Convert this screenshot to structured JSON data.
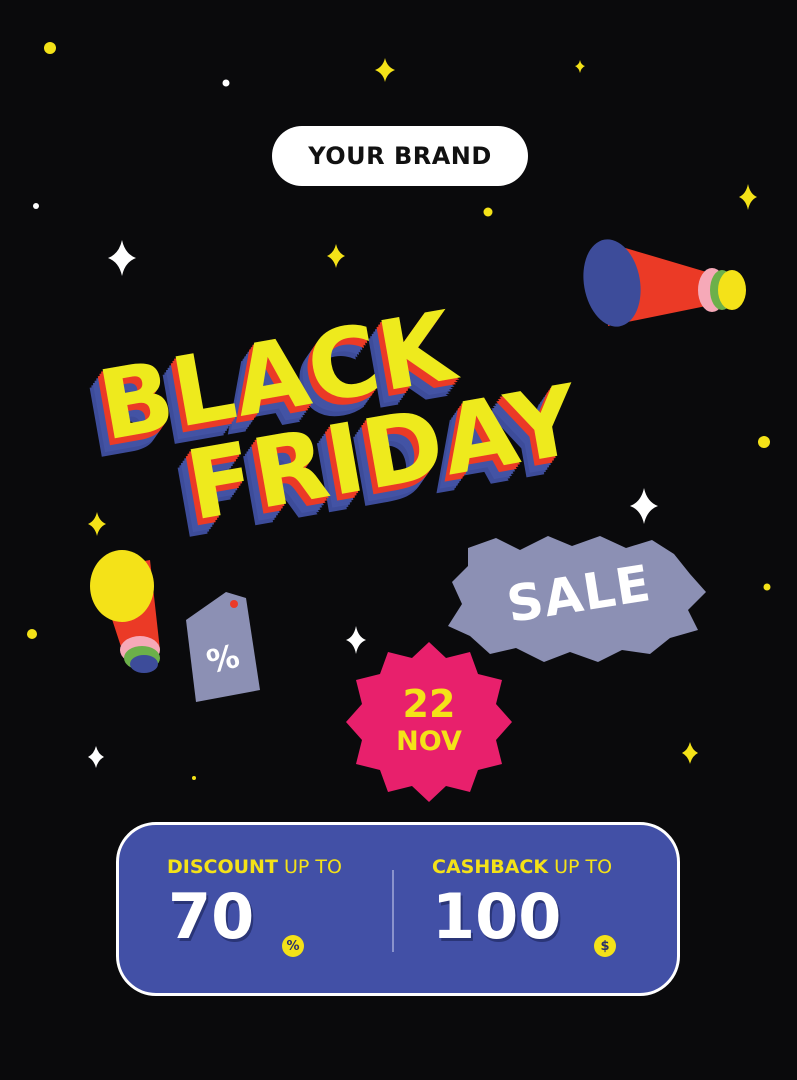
{
  "brand": {
    "label": "YOUR BRAND"
  },
  "headline": {
    "line1": "BLACK",
    "line2": "FRIDAY"
  },
  "sale_badge": {
    "label": "SALE"
  },
  "price_tag": {
    "symbol": "%"
  },
  "date_badge": {
    "day": "22",
    "month": "NOV"
  },
  "offers": {
    "discount": {
      "label_bold": "DISCOUNT",
      "label_rest": " UP TO",
      "value": "70",
      "unit": "%"
    },
    "cashback": {
      "label_bold": "CASHBACK",
      "label_rest": " UP TO",
      "value": "100",
      "unit": "$"
    }
  },
  "colors": {
    "background": "#0a0a0c",
    "headline_face": "#eeea1d",
    "headline_red": "#eb3a26",
    "headline_blue": "#4353a4",
    "sale_badge": "#8c90b4",
    "date_badge": "#e8206c",
    "panel": "#4250a6",
    "accent_yellow": "#f4e218"
  },
  "decorations": {
    "icons": [
      "sparkle-icon",
      "dot-icon",
      "megaphone-icon",
      "price-tag-icon"
    ]
  }
}
